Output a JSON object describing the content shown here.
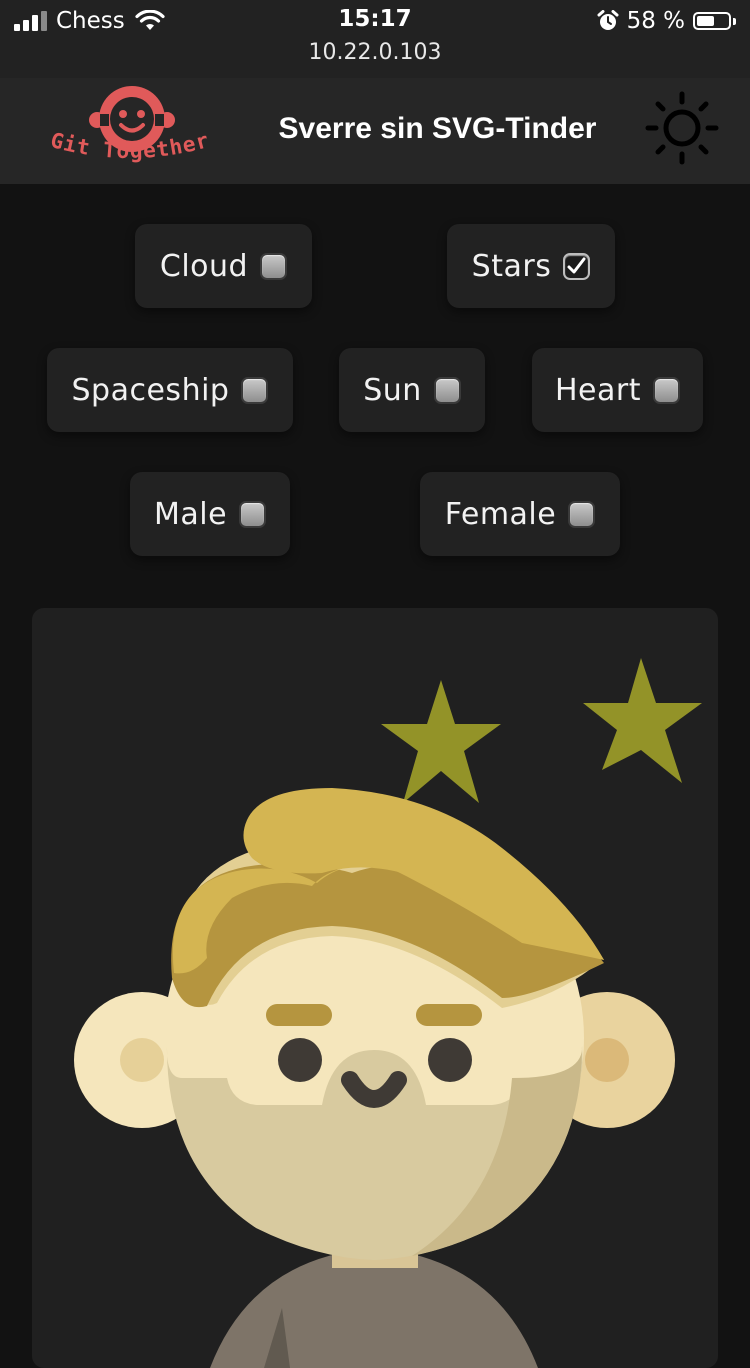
{
  "status_bar": {
    "carrier": "Chess",
    "time": "15:17",
    "url": "10.22.0.103",
    "battery_percent": "58 %",
    "battery_level": 0.58,
    "icons": [
      "signal-icon",
      "wifi-icon",
      "alarm-icon",
      "battery-icon"
    ]
  },
  "header": {
    "logo_text": "Git Together",
    "title": "Sverre sin SVG-Tinder",
    "theme_toggle_icon": "sun-icon"
  },
  "filters": [
    {
      "label": "Cloud",
      "checked": false
    },
    {
      "label": "Stars",
      "checked": true
    },
    {
      "label": "Spaceship",
      "checked": false
    },
    {
      "label": "Sun",
      "checked": false
    },
    {
      "label": "Heart",
      "checked": false
    },
    {
      "label": "Male",
      "checked": false
    },
    {
      "label": "Female",
      "checked": false
    }
  ],
  "colors": {
    "background": "#121212",
    "header": "#262626",
    "chip": "#222222",
    "card": "#202020",
    "logo_red": "#e05a5a",
    "star": "#939328",
    "hair_light": "#d4b552",
    "hair_dark": "#b5953f",
    "skin": "#f5e6bc"
  }
}
